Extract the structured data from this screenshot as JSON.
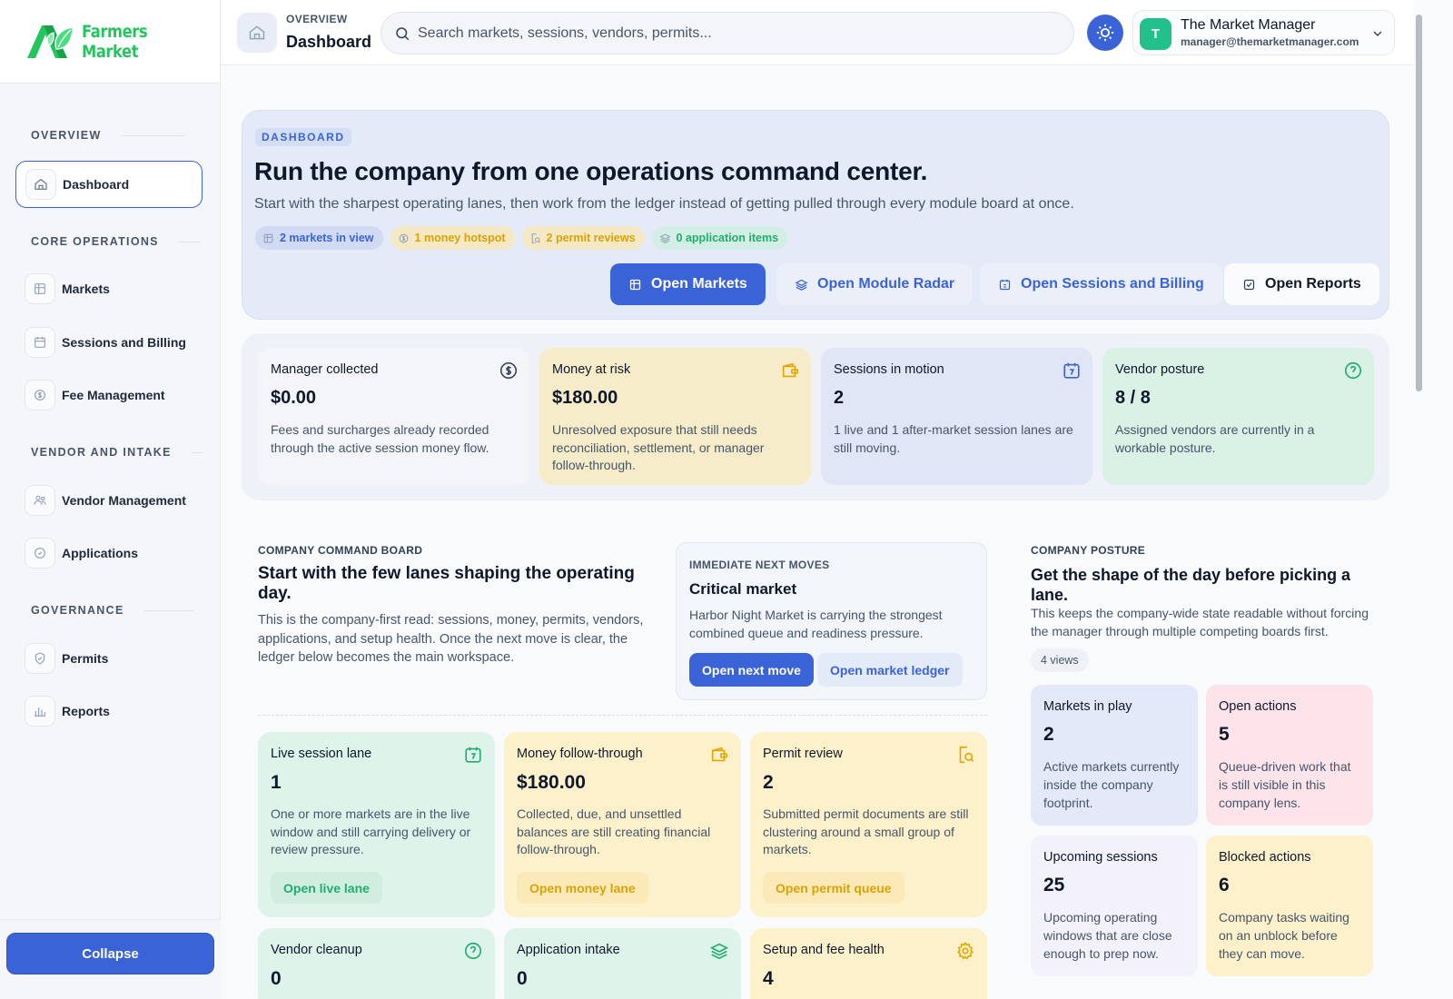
{
  "colors": {
    "accent": "#3b63d8",
    "brand_green": "#22c55e",
    "amber": "#d9a307",
    "sidebar_bg": "#f4f6fa"
  },
  "brand": {
    "name": "Farmers Market",
    "logo_icon": "leaf-logo-icon"
  },
  "sidebar": {
    "sections": [
      {
        "label": "OVERVIEW",
        "items": [
          {
            "label": "Dashboard",
            "icon": "home-icon",
            "active": true
          }
        ]
      },
      {
        "label": "CORE OPERATIONS",
        "items": [
          {
            "label": "Markets",
            "icon": "storefront-icon"
          },
          {
            "label": "Sessions and Billing",
            "icon": "calendar-icon"
          },
          {
            "label": "Fee Management",
            "icon": "dollar-circle-icon"
          }
        ]
      },
      {
        "label": "VENDOR AND INTAKE",
        "items": [
          {
            "label": "Vendor Management",
            "icon": "users-icon"
          },
          {
            "label": "Applications",
            "icon": "clipboard-icon"
          }
        ]
      },
      {
        "label": "GOVERNANCE",
        "items": [
          {
            "label": "Permits",
            "icon": "shield-icon"
          },
          {
            "label": "Reports",
            "icon": "bar-chart-icon"
          }
        ]
      }
    ],
    "collapse_label": "Collapse"
  },
  "header": {
    "crumb_top": "OVERVIEW",
    "crumb_main": "Dashboard",
    "search_placeholder": "Search markets, sessions, vendors, permits...",
    "user": {
      "initial": "T",
      "name": "The Market Manager",
      "email": "manager@themarketmanager.com"
    }
  },
  "hero": {
    "tag": "DASHBOARD",
    "title": "Run the company from one operations command center.",
    "subtitle": "Start with the sharpest operating lanes, then work from the ledger instead of getting pulled through every module board at once.",
    "chips": [
      {
        "label": "2 markets in view",
        "icon": "storefront-icon"
      },
      {
        "label": "1 money hotspot",
        "icon": "dollar-circle-icon"
      },
      {
        "label": "2 permit reviews",
        "icon": "search-doc-icon"
      },
      {
        "label": "0 application items",
        "icon": "layers-icon"
      }
    ],
    "buttons": {
      "markets": "Open Markets",
      "radar": "Open Module Radar",
      "sessions": "Open Sessions and Billing",
      "reports": "Open Reports"
    }
  },
  "metrics": [
    {
      "label": "Manager collected",
      "value": "$0.00",
      "desc": "Fees and surcharges already recorded through the active session money flow.",
      "icon": "dollar-circle-icon",
      "bg": "#f3f5f8"
    },
    {
      "label": "Money at risk",
      "value": "$180.00",
      "desc": "Unresolved exposure that still needs reconciliation, settlement, or manager follow-through.",
      "icon": "wallet-icon",
      "bg": "#f6ecc9"
    },
    {
      "label": "Sessions in motion",
      "value": "2",
      "desc": "1 live and 1 after-market session lanes are still moving.",
      "icon": "calendar-icon",
      "bg": "#e1e6f6"
    },
    {
      "label": "Vendor posture",
      "value": "8 / 8",
      "desc": "Assigned vendors are currently in a workable posture.",
      "icon": "help-circle-icon",
      "bg": "#daf1e6"
    }
  ],
  "command_board": {
    "eyebrow": "COMPANY COMMAND BOARD",
    "title": "Start with the few lanes shaping the operating day.",
    "desc": "This is the company-first read: sessions, money, permits, vendors, applications, and setup health. Once the next move is clear, the ledger below becomes the main workspace.",
    "next": {
      "eyebrow": "IMMEDIATE NEXT MOVES",
      "title": "Critical market",
      "desc": "Harbor Night Market is carrying the strongest combined queue and readiness pressure.",
      "primary": "Open next move",
      "secondary": "Open market ledger"
    },
    "lanes": [
      {
        "label": "Live session lane",
        "value": "1",
        "desc": "One or more markets are in the live window and still carrying delivery or review pressure.",
        "button": "Open live lane",
        "icon": "calendar-icon"
      },
      {
        "label": "Money follow-through",
        "value": "$180.00",
        "desc": "Collected, due, and unsettled balances are still creating financial follow-through.",
        "button": "Open money lane",
        "icon": "wallet-icon"
      },
      {
        "label": "Permit review",
        "value": "2",
        "desc": "Submitted permit documents are still clustering around a small group of markets.",
        "button": "Open permit queue",
        "icon": "search-doc-icon"
      },
      {
        "label": "Vendor cleanup",
        "value": "0",
        "icon": "help-circle-icon"
      },
      {
        "label": "Application intake",
        "value": "0",
        "icon": "layers-icon"
      },
      {
        "label": "Setup and fee health",
        "value": "4",
        "icon": "gear-icon"
      }
    ]
  },
  "posture": {
    "eyebrow": "COMPANY POSTURE",
    "title": "Get the shape of the day before picking a lane.",
    "desc": "This keeps the company-wide state readable without forcing the manager through multiple competing boards first.",
    "views": "4 views",
    "cards": [
      {
        "label": "Markets in play",
        "value": "2",
        "desc": "Active markets currently inside the company footprint."
      },
      {
        "label": "Open actions",
        "value": "5",
        "desc": "Queue-driven work that is still visible in this company lens."
      },
      {
        "label": "Upcoming sessions",
        "value": "25",
        "desc": "Upcoming operating windows that are close enough to prep now."
      },
      {
        "label": "Blocked actions",
        "value": "6",
        "desc": "Company tasks waiting on an unblock before they can move."
      }
    ]
  }
}
